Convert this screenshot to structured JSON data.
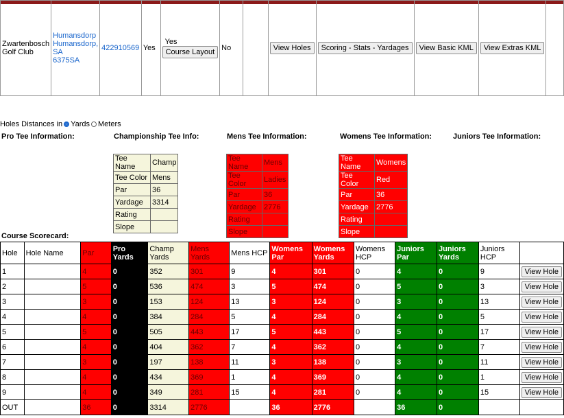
{
  "club": {
    "name": "Zwartenbosch Golf Club",
    "address": [
      "Humansdorp",
      "Humansdorp,",
      "SA",
      "6375SA"
    ],
    "phone": "422910569",
    "col_yes": "Yes",
    "course_yes": "Yes",
    "course_layout_btn": "Course Layout",
    "col_no": "No",
    "view_holes_btn": "View Holes",
    "scoring_btn": "Scoring - Stats - Yardages",
    "basic_kml_btn": "View Basic KML",
    "extras_kml_btn": "View Extras KML"
  },
  "units": {
    "label": "Holes Distances in",
    "yards": "Yards",
    "meters": "Meters",
    "selected": "Yards"
  },
  "tee_headers": {
    "pro": "Pro Tee Information:",
    "champ": "Championship Tee Info:",
    "mens": "Mens Tee Information:",
    "womens": "Womens Tee Information:",
    "juniors": "Juniors Tee Information:"
  },
  "tee_labels": [
    "Tee Name",
    "Tee Color",
    "Par",
    "Yardage",
    "Rating",
    "Slope"
  ],
  "champ_tee": [
    "Champ",
    "Mens",
    "36",
    "3314",
    "",
    ""
  ],
  "mens_tee": [
    "Mens",
    "Ladies",
    "36",
    "2776",
    "",
    ""
  ],
  "womens_tee": [
    "Womens",
    "Red",
    "36",
    "2776",
    "",
    ""
  ],
  "scorecard": {
    "label": "Course Scorecard:",
    "headers": [
      "Hole",
      "Hole Name",
      "Par",
      "Pro Yards",
      "Champ Yards",
      "Mens Yards",
      "Mens HCP",
      "Womens Par",
      "Womens Yards",
      "Womens HCP",
      "Juniors Par",
      "Juniors Yards",
      "Juniors HCP",
      ""
    ],
    "view_label": "View Hole",
    "rows": [
      [
        "1",
        "",
        "4",
        "0",
        "352",
        "301",
        "9",
        "4",
        "301",
        "0",
        "4",
        "0",
        "9"
      ],
      [
        "2",
        "",
        "5",
        "0",
        "536",
        "474",
        "3",
        "5",
        "474",
        "0",
        "5",
        "0",
        "3"
      ],
      [
        "3",
        "",
        "3",
        "0",
        "153",
        "124",
        "13",
        "3",
        "124",
        "0",
        "3",
        "0",
        "13"
      ],
      [
        "4",
        "",
        "4",
        "0",
        "384",
        "284",
        "5",
        "4",
        "284",
        "0",
        "4",
        "0",
        "5"
      ],
      [
        "5",
        "",
        "5",
        "0",
        "505",
        "443",
        "17",
        "5",
        "443",
        "0",
        "5",
        "0",
        "17"
      ],
      [
        "6",
        "",
        "4",
        "0",
        "404",
        "362",
        "7",
        "4",
        "362",
        "0",
        "4",
        "0",
        "7"
      ],
      [
        "7",
        "",
        "3",
        "0",
        "197",
        "138",
        "11",
        "3",
        "138",
        "0",
        "3",
        "0",
        "11"
      ],
      [
        "8",
        "",
        "4",
        "0",
        "434",
        "369",
        "1",
        "4",
        "369",
        "0",
        "4",
        "0",
        "1"
      ],
      [
        "9",
        "",
        "4",
        "0",
        "349",
        "281",
        "15",
        "4",
        "281",
        "0",
        "4",
        "0",
        "15"
      ]
    ],
    "out_row": [
      "OUT",
      "",
      "36",
      "0",
      "3314",
      "2776",
      "",
      "36",
      "2776",
      "",
      "36",
      "0",
      ""
    ]
  }
}
